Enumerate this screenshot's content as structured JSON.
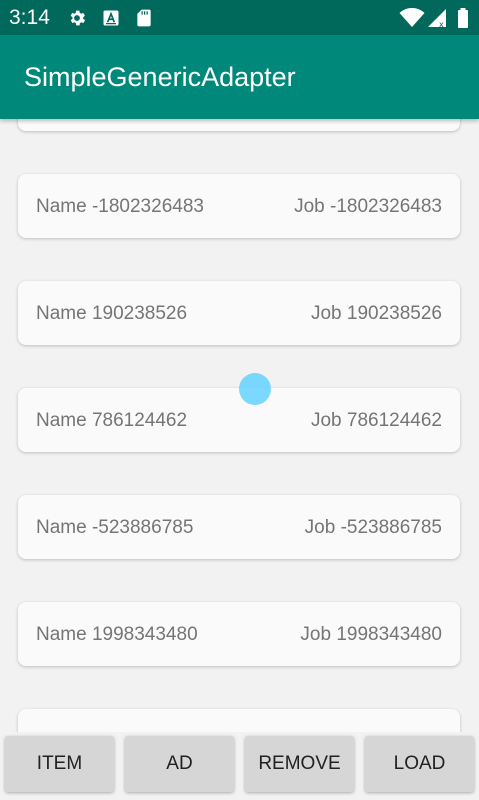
{
  "status_bar": {
    "time": "3:14",
    "icons": [
      "gear-icon",
      "a-box-icon",
      "sd-card-icon",
      "wifi-icon",
      "signal-icon",
      "battery-icon"
    ],
    "color": "#00695c"
  },
  "app_bar": {
    "title": "SimpleGenericAdapter",
    "color": "#00897b"
  },
  "list": {
    "items": [
      {
        "name": "Name -1802326483",
        "job": "Job -1802326483"
      },
      {
        "name": "Name 190238526",
        "job": "Job 190238526"
      },
      {
        "name": "Name 786124462",
        "job": "Job 786124462"
      },
      {
        "name": "Name -523886785",
        "job": "Job -523886785"
      },
      {
        "name": "Name 1998343480",
        "job": "Job 1998343480"
      }
    ]
  },
  "buttons": {
    "item": "ITEM",
    "ad": "AD",
    "remove": "REMOVE",
    "load": "LOAD"
  }
}
